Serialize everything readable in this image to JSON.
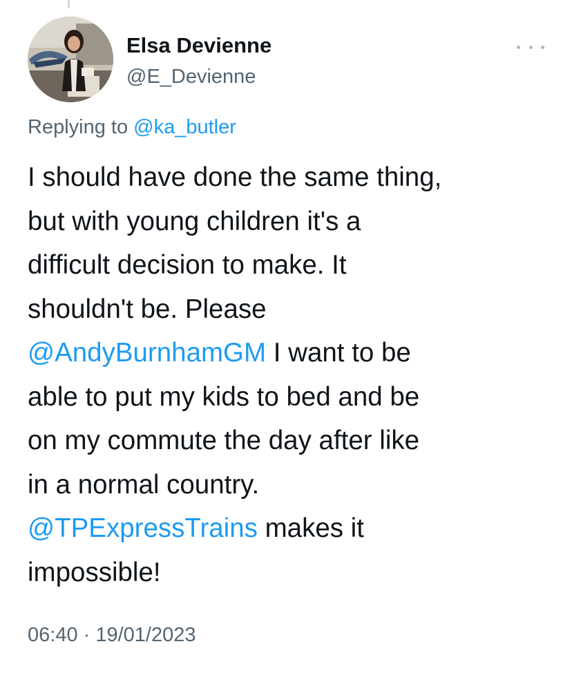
{
  "author": {
    "display_name": "Elsa Devienne",
    "handle": "@E_Devienne",
    "avatar_icon": "profile-photo"
  },
  "reply": {
    "prefix": "Replying to ",
    "to_handle": "@ka_butler"
  },
  "tweet": {
    "line1": "I should have done the same thing,",
    "line2": "but with young children it's a",
    "line3": "difficult decision to make. It",
    "line4": "shouldn't be. Please",
    "mention1": "@AndyBurnhamGM",
    "line5_rest": " I want to be",
    "line6": "able to put my kids to bed and be",
    "line7": "on my commute the day after like",
    "line8": "in a normal country.",
    "mention2": "@TPExpressTrains",
    "line9_rest": " makes it",
    "line10": "impossible!"
  },
  "meta": {
    "timestamp": "06:40 · 19/01/2023"
  },
  "colors": {
    "link": "#1d9bf0",
    "secondary_text": "#536471",
    "primary_text": "#0f1419",
    "more_dots": "#aab8c2"
  },
  "icons": {
    "more": "more-horizontal-icon"
  }
}
